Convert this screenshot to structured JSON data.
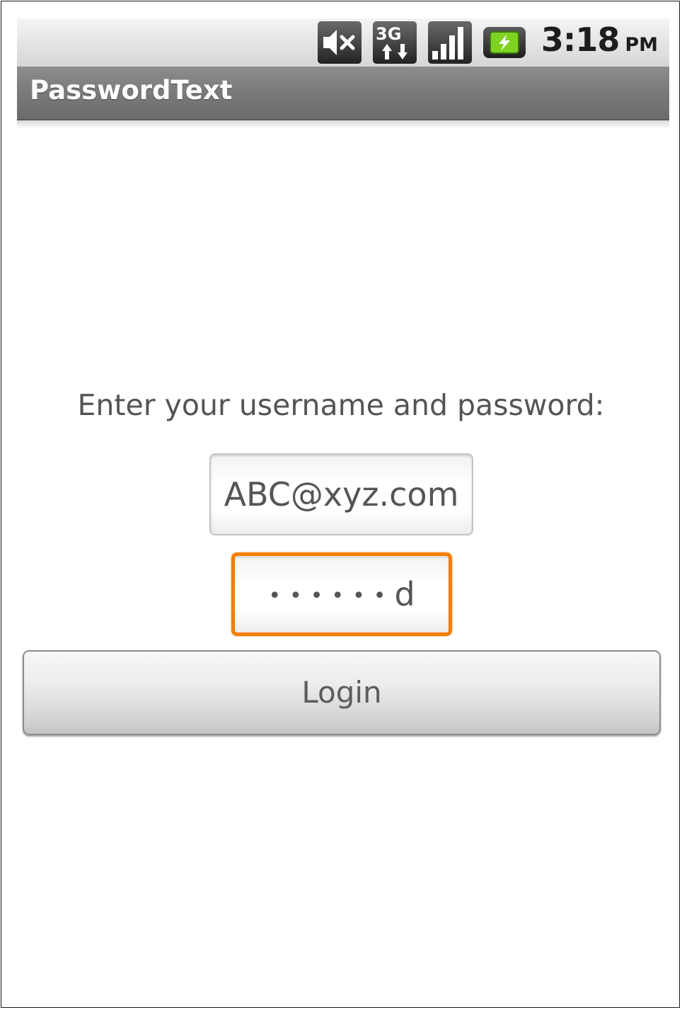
{
  "status_bar": {
    "time": "3:18",
    "ampm": "PM",
    "icons": [
      "sound-muted-icon",
      "3g-data-icon",
      "signal-strength-icon",
      "battery-charging-icon"
    ],
    "network_label": "3G"
  },
  "app_bar": {
    "title": "PasswordText"
  },
  "form": {
    "prompt": "Enter your username and password:",
    "username_value": "ABC@xyz.com",
    "password_masked": "••••••",
    "password_last_char": "d",
    "login_label": "Login"
  },
  "colors": {
    "focus_accent": "#f57d00",
    "title_bar": "#7a7a7a",
    "text": "#555555"
  }
}
